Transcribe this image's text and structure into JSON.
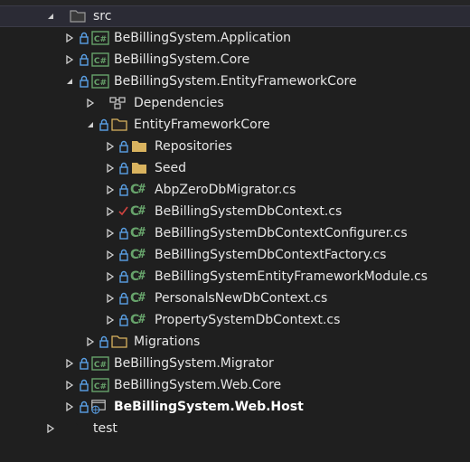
{
  "tree": {
    "src": "src",
    "app": "BeBillingSystem.Application",
    "core": "BeBillingSystem.Core",
    "efcore_project": "BeBillingSystem.EntityFrameworkCore",
    "dependencies": "Dependencies",
    "ef_folder": "EntityFrameworkCore",
    "repositories": "Repositories",
    "seed": "Seed",
    "files": [
      "AbpZeroDbMigrator.cs",
      "BeBillingSystemDbContext.cs",
      "BeBillingSystemDbContextConfigurer.cs",
      "BeBillingSystemDbContextFactory.cs",
      "BeBillingSystemEntityFrameworkModule.cs",
      "PersonalsNewDbContext.cs",
      "PropertySystemDbContext.cs"
    ],
    "migrations": "Migrations",
    "migrator": "BeBillingSystem.Migrator",
    "webcore": "BeBillingSystem.Web.Core",
    "webhost": "BeBillingSystem.Web.Host",
    "test": "test"
  },
  "colors": {
    "background": "#1f1f1f",
    "selected_row": "#2b2b35",
    "folder": "#d9b35f",
    "project_green": "#3f8f4f",
    "lock_blue": "#5aa0e6",
    "check_red": "#d0433f"
  }
}
